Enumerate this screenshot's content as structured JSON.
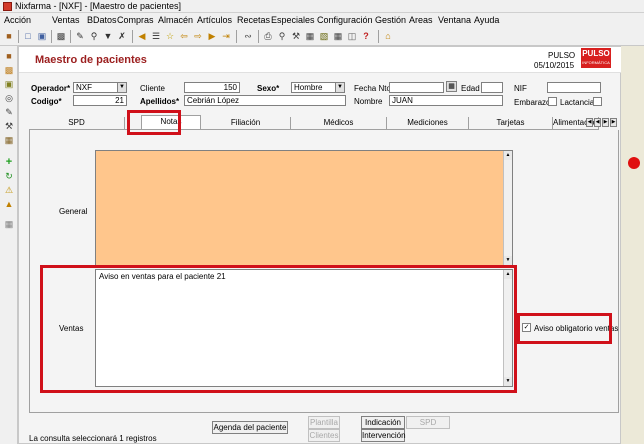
{
  "window": {
    "title": "Nixfarma - [NXF] - [Maestro de pacientes]"
  },
  "menu": [
    "Acción",
    "Ventas",
    "BDatos",
    "Compras",
    "Almacén",
    "Artículos",
    "Recetas",
    "Especiales",
    "Configuración",
    "Gestión",
    "Areas",
    "Ventana",
    "Ayuda"
  ],
  "page": {
    "title": "Maestro de pacientes"
  },
  "brand": {
    "name": "PULSO",
    "date": "05/10/2015",
    "logo_text": "PULSO",
    "logo_sub": "INFORMÁTICA"
  },
  "form": {
    "operador_label": "Operador*",
    "operador_value": "NXF",
    "cliente_label": "Cliente",
    "cliente_value": "150",
    "sexo_label": "Sexo*",
    "sexo_value": "Hombre",
    "fecha_nto_label": "Fecha Nto",
    "fecha_nto_value": "",
    "edad_label": "Edad",
    "edad_value": "",
    "nif_label": "NIF",
    "nif_value": "",
    "codigo_label": "Codigo*",
    "codigo_value": "21",
    "apellidos_label": "Apellidos*",
    "apellidos_value": "Cebrián López",
    "nombre_label": "Nombre",
    "nombre_value": "JUAN",
    "embarazo_label": "Embarazo",
    "lactancia_label": "Lactancia"
  },
  "tabs": [
    "SPD",
    "Notas",
    "Filiación",
    "Médicos",
    "Mediciones",
    "Tarjetas",
    "Alimentación infantil"
  ],
  "notes": {
    "general_label": "General",
    "general_text": "",
    "ventas_label": "Ventas",
    "ventas_text": "Aviso en ventas para el paciente 21",
    "aviso_label": "Aviso obligatorio ventas",
    "aviso_checked": true
  },
  "status": {
    "text": "La consulta seleccionará 1  registros"
  },
  "buttons": {
    "agenda": "Agenda del paciente",
    "plantilla": "Plantilla",
    "clientes": "Clientes",
    "indicacion": "Indicación",
    "intervencion": "Intervención",
    "spd": "SPD"
  },
  "colors": {
    "general_bg": "#ffc68c",
    "highlight": "#d0101a",
    "title": "#9c2020"
  }
}
